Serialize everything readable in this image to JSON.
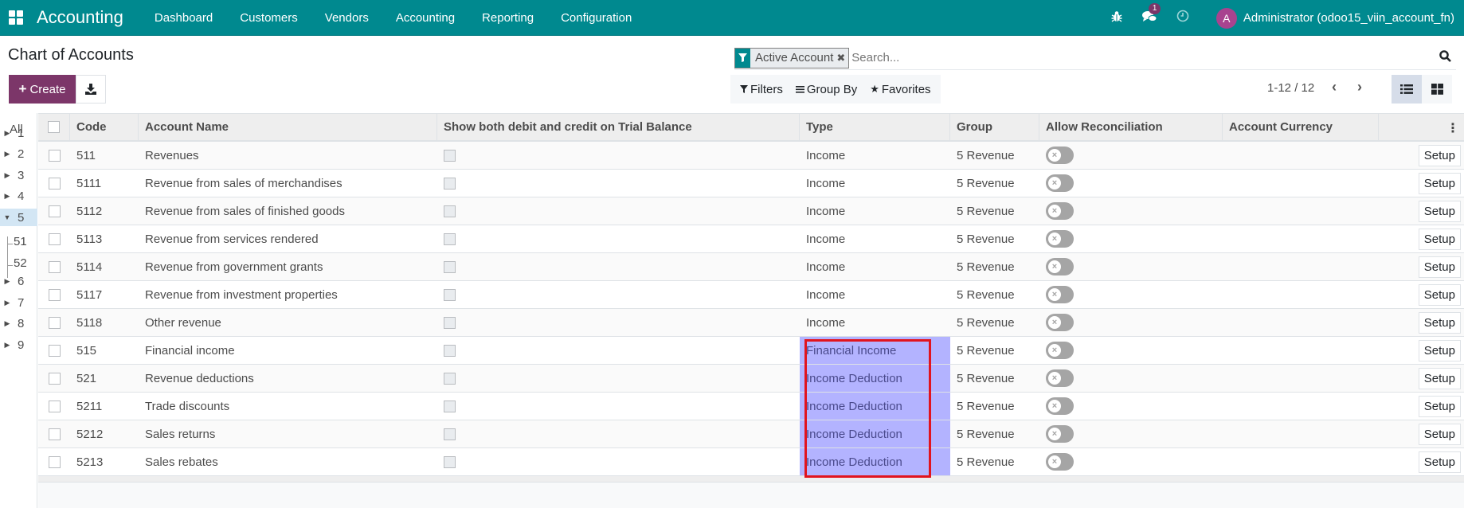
{
  "navbar": {
    "app_name": "Accounting",
    "menu": [
      "Dashboard",
      "Customers",
      "Vendors",
      "Accounting",
      "Reporting",
      "Configuration"
    ],
    "message_count": "1",
    "avatar_letter": "A",
    "user": "Administrator (odoo15_viin_account_fn)"
  },
  "control_panel": {
    "title": "Chart of Accounts",
    "create_label": "Create",
    "search": {
      "facet": "Active Account",
      "placeholder": "Search..."
    },
    "filters_label": "Filters",
    "group_by_label": "Group By",
    "favorites_label": "Favorites",
    "pager": "1-12 / 12"
  },
  "tree": {
    "all_label": "All",
    "items": [
      "1",
      "2",
      "3",
      "4",
      "5",
      "6",
      "7",
      "8",
      "9"
    ],
    "expanded": "5",
    "children": [
      "51",
      "52"
    ]
  },
  "table": {
    "columns": [
      "Code",
      "Account Name",
      "Show both debit and credit on Trial Balance",
      "Type",
      "Group",
      "Allow Reconciliation",
      "Account Currency"
    ],
    "setup_label": "Setup",
    "rows": [
      {
        "code": "511",
        "name": "Revenues",
        "type": "Income",
        "group": "5 Revenue",
        "highlighted": false
      },
      {
        "code": "5111",
        "name": "Revenue from sales of merchandises",
        "type": "Income",
        "group": "5 Revenue",
        "highlighted": false
      },
      {
        "code": "5112",
        "name": "Revenue from sales of finished goods",
        "type": "Income",
        "group": "5 Revenue",
        "highlighted": false
      },
      {
        "code": "5113",
        "name": "Revenue from services rendered",
        "type": "Income",
        "group": "5 Revenue",
        "highlighted": false
      },
      {
        "code": "5114",
        "name": "Revenue from government grants",
        "type": "Income",
        "group": "5 Revenue",
        "highlighted": false
      },
      {
        "code": "5117",
        "name": "Revenue from investment properties",
        "type": "Income",
        "group": "5 Revenue",
        "highlighted": false
      },
      {
        "code": "5118",
        "name": "Other revenue",
        "type": "Income",
        "group": "5 Revenue",
        "highlighted": false
      },
      {
        "code": "515",
        "name": "Financial income",
        "type": "Financial Income",
        "group": "5 Revenue",
        "highlighted": true
      },
      {
        "code": "521",
        "name": "Revenue deductions",
        "type": "Income Deduction",
        "group": "5 Revenue",
        "highlighted": true
      },
      {
        "code": "5211",
        "name": "Trade discounts",
        "type": "Income Deduction",
        "group": "5 Revenue",
        "highlighted": true
      },
      {
        "code": "5212",
        "name": "Sales returns",
        "type": "Income Deduction",
        "group": "5 Revenue",
        "highlighted": true
      },
      {
        "code": "5213",
        "name": "Sales rebates",
        "type": "Income Deduction",
        "group": "5 Revenue",
        "highlighted": true
      }
    ]
  },
  "colors": {
    "navbar": "#00898f",
    "primary": "#7c3669",
    "highlight_fill": "#b3b3ff",
    "highlight_border": "#e1141e"
  }
}
